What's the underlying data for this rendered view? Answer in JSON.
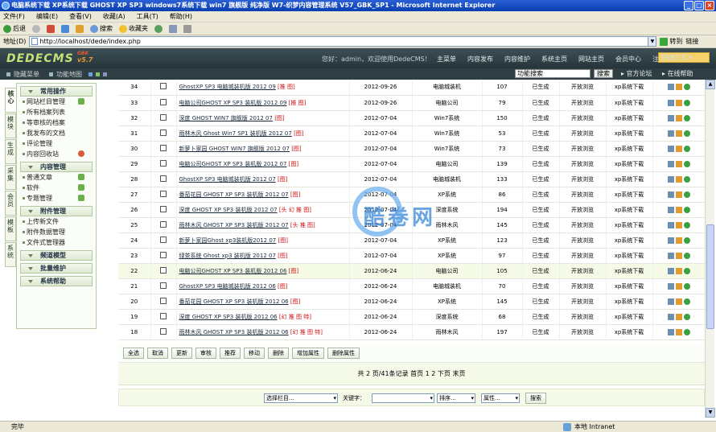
{
  "window": {
    "title": "电脑系统下载 XP系统下载 GHOST XP SP3 windows7系统下载 win7 旗舰版 纯净版 W7-织梦内容管理系统 V57_GBK_SP1 - Microsoft Internet Explorer"
  },
  "menubar": [
    "文件(F)",
    "编辑(E)",
    "查看(V)",
    "收藏(A)",
    "工具(T)",
    "帮助(H)"
  ],
  "toolbar": {
    "back": "后退",
    "search": "搜索",
    "favorites": "收藏夹"
  },
  "address": {
    "label": "地址(D)",
    "url": "http://localhost/dede/index.php",
    "go": "转到",
    "links": "链接"
  },
  "dede": {
    "logo": "DEDECMS",
    "version": "v5.7",
    "gbk": "GBK",
    "welcome": "您好：admin，欢迎使用DedeCMS！",
    "topnav": [
      "主菜单",
      "内容发布",
      "内容维护",
      "系统主页",
      "网站主页",
      "会员中心",
      "注销"
    ],
    "quick": "快捷方式",
    "sub_left": [
      "隐藏菜单",
      "功能地图"
    ],
    "fn_search_placeholder": "功能搜索",
    "fn_search_btn": "搜索",
    "forum": "官方论坛",
    "help": "在线帮助"
  },
  "vtabs": [
    "核心",
    "模块",
    "生成",
    "采集",
    "会员",
    "模板",
    "系统"
  ],
  "groups": [
    {
      "title": "常用操作",
      "items": [
        {
          "label": "网站栏目管理",
          "icon": "plus"
        },
        {
          "label": "所有档案列表",
          "icon": ""
        },
        {
          "label": "等审核的档案",
          "icon": ""
        },
        {
          "label": "我发布的文档",
          "icon": ""
        },
        {
          "label": "评论管理",
          "icon": ""
        },
        {
          "label": "内容回收站",
          "icon": "red"
        }
      ]
    },
    {
      "title": "内容管理",
      "items": [
        {
          "label": "普通文章",
          "icon": "plus"
        },
        {
          "label": "软件",
          "icon": "plus"
        },
        {
          "label": "专题管理",
          "icon": "plus"
        }
      ]
    },
    {
      "title": "附件管理",
      "items": [
        {
          "label": "上传新文件",
          "icon": ""
        },
        {
          "label": "附件数据管理",
          "icon": ""
        },
        {
          "label": "文件式管理器",
          "icon": ""
        }
      ]
    },
    {
      "title": "频道模型",
      "items": []
    },
    {
      "title": "批量维护",
      "items": []
    },
    {
      "title": "系统帮助",
      "items": []
    }
  ],
  "rows": [
    {
      "id": "34",
      "title": "GhostXP SP3 电脑城装机版 2012 09",
      "flag": "[推 图]",
      "date": "2012-09-26",
      "cat": "电脑城装机",
      "clicks": "107",
      "status": "已生成",
      "rank": "开放浏览",
      "author": "xp系统下载"
    },
    {
      "id": "33",
      "title": "电脑公司GHOST XP SP3 装机版 2012 09",
      "flag": "[推 图]",
      "date": "2012-09-26",
      "cat": "电脑公司",
      "clicks": "79",
      "status": "已生成",
      "rank": "开放浏览",
      "author": "xp系统下载"
    },
    {
      "id": "32",
      "title": "深度 GHOST WIN7 旗舰版 2012 07",
      "flag": "[图]",
      "date": "2012-07-04",
      "cat": "Win7系统",
      "clicks": "150",
      "status": "已生成",
      "rank": "开放浏览",
      "author": "xp系统下载"
    },
    {
      "id": "31",
      "title": "雨林木风 Ghost Win7 SP1 装机版 2012 07",
      "flag": "[图]",
      "date": "2012-07-04",
      "cat": "Win7系统",
      "clicks": "53",
      "status": "已生成",
      "rank": "开放浏览",
      "author": "xp系统下载"
    },
    {
      "id": "30",
      "title": "新萝卜家园 GHOST WIN7 旗舰版 2012 07",
      "flag": "[图]",
      "date": "2012-07-04",
      "cat": "Win7系统",
      "clicks": "73",
      "status": "已生成",
      "rank": "开放浏览",
      "author": "xp系统下载"
    },
    {
      "id": "29",
      "title": "电脑公司GHOST XP SP3 装机版 2012 07",
      "flag": "[图]",
      "date": "2012-07-04",
      "cat": "电脑公司",
      "clicks": "139",
      "status": "已生成",
      "rank": "开放浏览",
      "author": "xp系统下载"
    },
    {
      "id": "28",
      "title": "GhostXP SP3 电脑城装机版 2012 07",
      "flag": "[图]",
      "date": "2012-07-04",
      "cat": "电脑城装机",
      "clicks": "133",
      "status": "已生成",
      "rank": "开放浏览",
      "author": "xp系统下载"
    },
    {
      "id": "27",
      "title": "番茄花园 GHOST XP SP3 装机版 2012 07",
      "flag": "[图]",
      "date": "2012-07-04",
      "cat": "XP系统",
      "clicks": "86",
      "status": "已生成",
      "rank": "开放浏览",
      "author": "xp系统下载"
    },
    {
      "id": "26",
      "title": "深度 GHOST XP SP3 装机版 2012 07",
      "flag": "[头 幻 推 图]",
      "date": "2012-07-04",
      "cat": "深度系统",
      "clicks": "194",
      "status": "已生成",
      "rank": "开放浏览",
      "author": "xp系统下载"
    },
    {
      "id": "25",
      "title": "雨林木风 GHOST XP SP3 装机版 2012 07",
      "flag": "[头 推 图]",
      "date": "2012-07-04",
      "cat": "雨林木风",
      "clicks": "145",
      "status": "已生成",
      "rank": "开放浏览",
      "author": "xp系统下载"
    },
    {
      "id": "24",
      "title": "新萝卜家园Ghost xp3装机版2012 07",
      "flag": "[图]",
      "date": "2012-07-04",
      "cat": "XP系统",
      "clicks": "123",
      "status": "已生成",
      "rank": "开放浏览",
      "author": "xp系统下载"
    },
    {
      "id": "23",
      "title": "绿茶系统 Ghost xp3 装机版 2012 07",
      "flag": "[图]",
      "date": "2012-07-04",
      "cat": "XP系统",
      "clicks": "97",
      "status": "已生成",
      "rank": "开放浏览",
      "author": "xp系统下载"
    },
    {
      "id": "22",
      "title": "电脑公司GHOST XP SP3 装机版 2012 06",
      "flag": "[图]",
      "date": "2012-06-24",
      "cat": "电脑公司",
      "clicks": "105",
      "status": "已生成",
      "rank": "开放浏览",
      "author": "xp系统下载"
    },
    {
      "id": "21",
      "title": "GhostXP SP3 电脑城装机版 2012 06",
      "flag": "[图]",
      "date": "2012-06-24",
      "cat": "电脑城装机",
      "clicks": "70",
      "status": "已生成",
      "rank": "开放浏览",
      "author": "xp系统下载"
    },
    {
      "id": "20",
      "title": "番茄花园 GHOST XP SP3 装机版 2012 06",
      "flag": "[图]",
      "date": "2012-06-24",
      "cat": "XP系统",
      "clicks": "145",
      "status": "已生成",
      "rank": "开放浏览",
      "author": "xp系统下载"
    },
    {
      "id": "19",
      "title": "深度 GHOST XP SP3 装机版 2012 06",
      "flag": "[幻 推 图 特]",
      "date": "2012-06-24",
      "cat": "深度系统",
      "clicks": "68",
      "status": "已生成",
      "rank": "开放浏览",
      "author": "xp系统下载"
    },
    {
      "id": "18",
      "title": "雨林木风 GHOST XP SP3 装机版 2012 06",
      "flag": "[幻 推 图 特]",
      "date": "2012-06-24",
      "cat": "雨林木风",
      "clicks": "197",
      "status": "已生成",
      "rank": "开放浏览",
      "author": "xp系统下载"
    }
  ],
  "highlight_row": "22",
  "actions": [
    "全选",
    "取消",
    "更新",
    "审核",
    "推荐",
    "移动",
    "删除",
    "增加属性",
    "删除属性"
  ],
  "pager": "共 2 页/41条记录 首页 1 2 下页 末页",
  "search": {
    "channel": "选择栏目...",
    "keyword_label": "关键字：",
    "keyword": "",
    "order": "排序...",
    "attr": "属性...",
    "button": "搜索"
  },
  "watermark": "酷卷网",
  "status": {
    "left": "完毕",
    "zone": "本地 Intranet"
  }
}
